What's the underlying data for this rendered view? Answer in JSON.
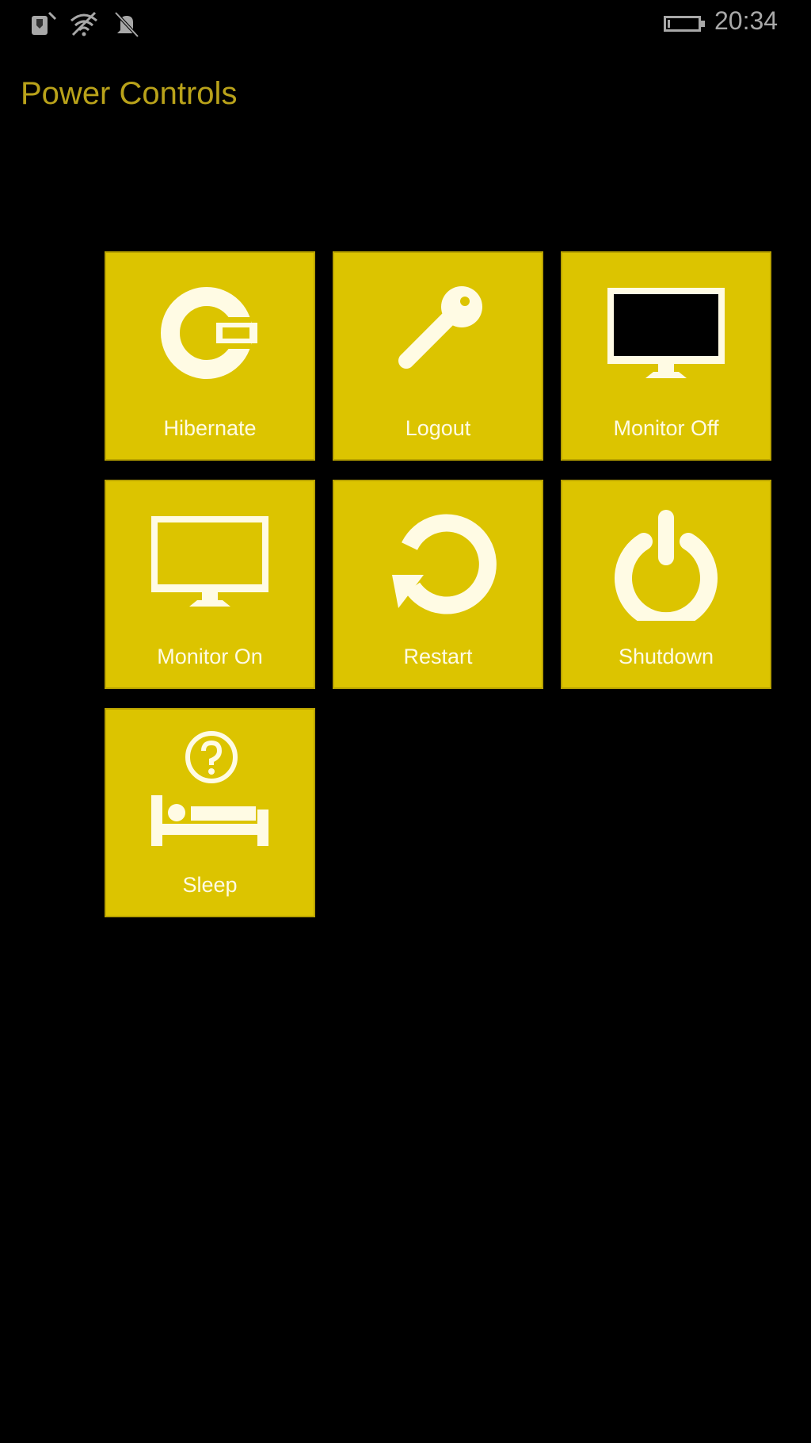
{
  "status_bar": {
    "icons": [
      "signal-icon",
      "wifi-off-icon",
      "silent-notification-icon"
    ],
    "battery_icon": "battery-icon",
    "time": "20:34"
  },
  "app": {
    "title": "Power Controls",
    "accent_color": "#b9a21a",
    "tile_color": "#dcc400"
  },
  "tiles": [
    {
      "label": "Hibernate",
      "icon": "hibernate-icon"
    },
    {
      "label": "Logout",
      "icon": "key-icon"
    },
    {
      "label": "Monitor Off",
      "icon": "monitor-off-icon"
    },
    {
      "label": "Monitor On",
      "icon": "monitor-on-icon"
    },
    {
      "label": "Restart",
      "icon": "restart-icon"
    },
    {
      "label": "Shutdown",
      "icon": "power-icon"
    },
    {
      "label": "Sleep",
      "icon": "sleep-icon"
    }
  ]
}
